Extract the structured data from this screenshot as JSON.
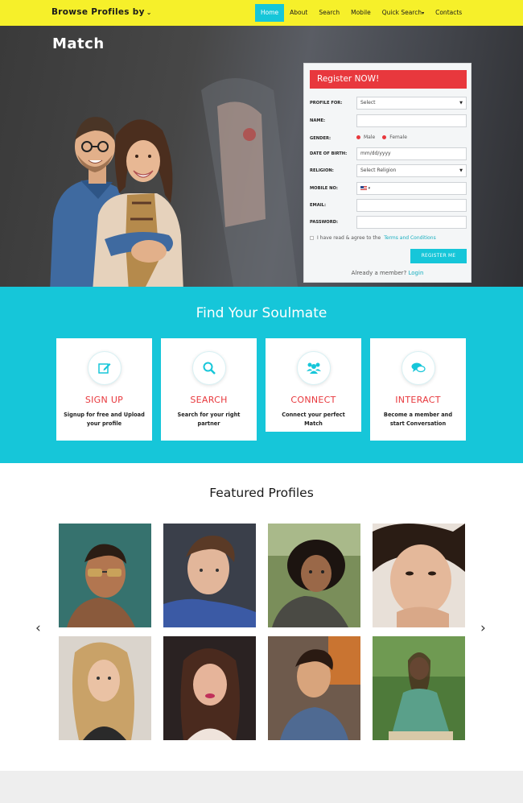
{
  "navbar": {
    "brand": "Browse Profiles by",
    "links": [
      "Home",
      "About",
      "Search",
      "Mobile",
      "Quick Search",
      "Contacts"
    ]
  },
  "hero": {
    "title": "Match"
  },
  "register": {
    "heading": "Register NOW!",
    "fields": {
      "profile_for": {
        "label": "PROFILE FOR:",
        "value": "Select"
      },
      "name": {
        "label": "NAME:",
        "value": ""
      },
      "gender": {
        "label": "GENDER:",
        "options": [
          "Male",
          "Female"
        ]
      },
      "dob": {
        "label": "DATE OF BIRTH:",
        "placeholder": "mm/dd/yyyy"
      },
      "religion": {
        "label": "RELIGION:",
        "value": "Select Religion"
      },
      "mobile": {
        "label": "MOBILE NO:",
        "value": ""
      },
      "email": {
        "label": "EMAIL:",
        "value": ""
      },
      "password": {
        "label": "PASSWORD:",
        "value": ""
      }
    },
    "terms_prefix": "I have read & agree to the",
    "terms_link": "Terms and Conditions",
    "button": "REGISTER ME",
    "already_text": "Already a member?",
    "login_link": "Login"
  },
  "soulmate": {
    "title": "Find Your Soulmate",
    "cards": [
      {
        "title": "SIGN UP",
        "desc": "Signup for free and Upload your profile",
        "icon": "edit-icon"
      },
      {
        "title": "SEARCH",
        "desc": "Search for your right partner",
        "icon": "search-icon"
      },
      {
        "title": "CONNECT",
        "desc": "Connect your perfect Match",
        "icon": "users-icon"
      },
      {
        "title": "INTERACT",
        "desc": "Become a member and start Conversation",
        "icon": "chat-icon"
      }
    ]
  },
  "featured": {
    "title": "Featured Profiles"
  },
  "colors": {
    "nav_bg": "#f6f02a",
    "accent": "#16c6d9",
    "red": "#e8383d"
  }
}
